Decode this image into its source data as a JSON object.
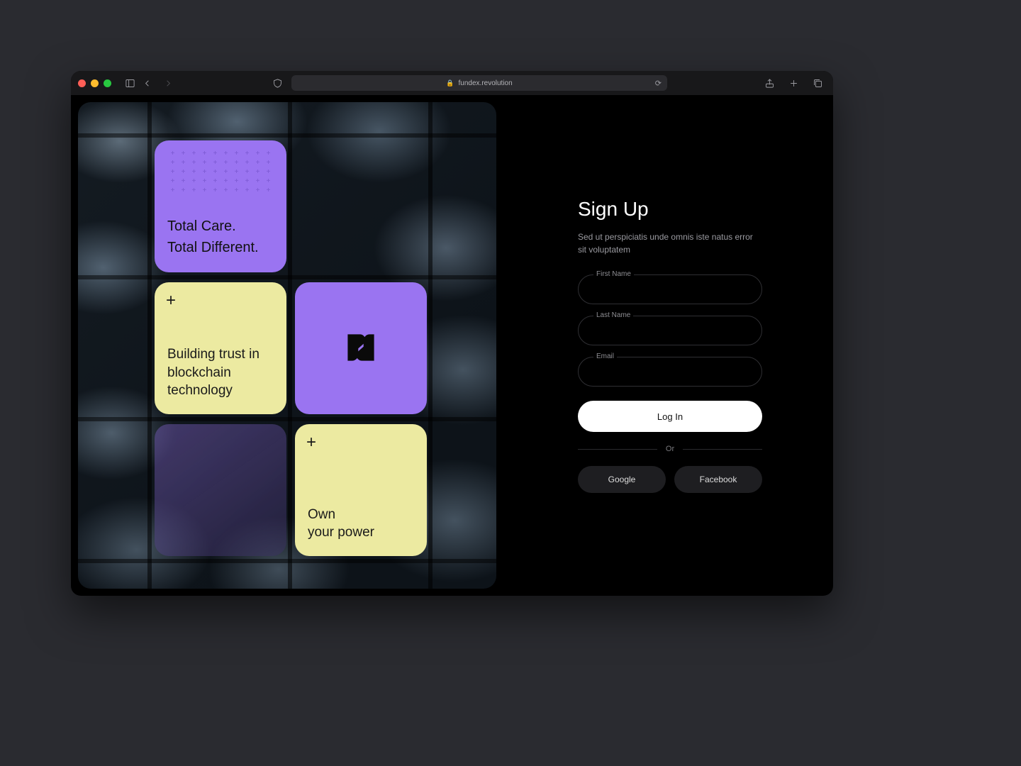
{
  "browser": {
    "url": "fundex.revolution"
  },
  "hero": {
    "card_totalcare": {
      "line1": "Total Care.",
      "line2": "Total Different."
    },
    "card_trust": {
      "text": "Building trust in blockchain technology"
    },
    "card_power": {
      "line1": "Own",
      "line2": "your power"
    }
  },
  "form": {
    "heading": "Sign Up",
    "subtext": "Sed ut perspiciatis unde omnis iste natus error sit voluptatem",
    "first_name_label": "First Name",
    "last_name_label": "Last Name",
    "email_label": "Email",
    "submit_label": "Log In",
    "separator": "Or",
    "oauth_google": "Google",
    "oauth_facebook": "Facebook"
  },
  "colors": {
    "purple": "#9a74f1",
    "cream": "#eceaa1"
  }
}
